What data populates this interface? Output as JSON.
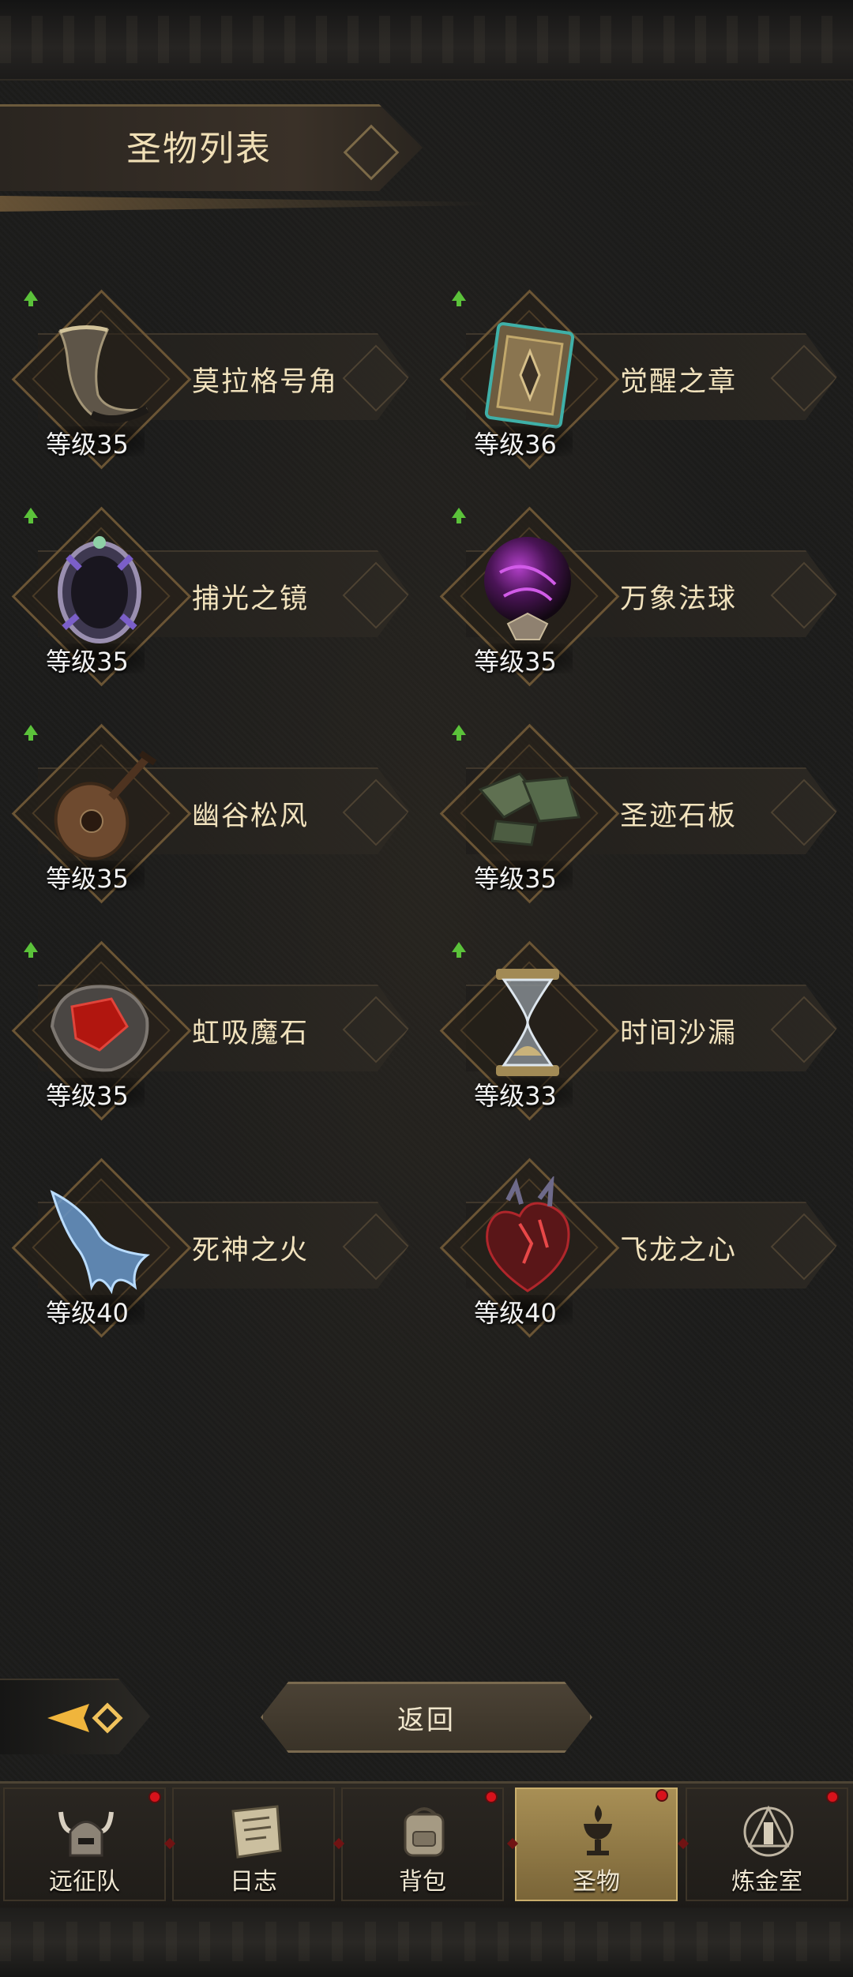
{
  "header": {
    "title": "圣物列表"
  },
  "relics": [
    {
      "name": "莫拉格号角",
      "level": "等级35",
      "upgrade": true,
      "icon": "horn-icon"
    },
    {
      "name": "觉醒之章",
      "level": "等级36",
      "upgrade": true,
      "icon": "tome-icon"
    },
    {
      "name": "捕光之镜",
      "level": "等级35",
      "upgrade": true,
      "icon": "mirror-icon"
    },
    {
      "name": "万象法球",
      "level": "等级35",
      "upgrade": true,
      "icon": "orb-icon"
    },
    {
      "name": "幽谷松风",
      "level": "等级35",
      "upgrade": true,
      "icon": "lute-icon"
    },
    {
      "name": "圣迹石板",
      "level": "等级35",
      "upgrade": true,
      "icon": "stone-tablet-icon"
    },
    {
      "name": "虹吸魔石",
      "level": "等级35",
      "upgrade": true,
      "icon": "siphon-stone-icon"
    },
    {
      "name": "时间沙漏",
      "level": "等级33",
      "upgrade": true,
      "icon": "hourglass-icon"
    },
    {
      "name": "死神之火",
      "level": "等级40",
      "upgrade": false,
      "icon": "spectral-hand-icon"
    },
    {
      "name": "飞龙之心",
      "level": "等级40",
      "upgrade": false,
      "icon": "dragon-heart-icon"
    }
  ],
  "actions": {
    "return_label": "返回"
  },
  "nav": {
    "items": [
      {
        "label": "远征队",
        "icon": "horned-helmet-icon",
        "badge": true,
        "active": false
      },
      {
        "label": "日志",
        "icon": "scroll-icon",
        "badge": false,
        "active": false
      },
      {
        "label": "背包",
        "icon": "backpack-icon",
        "badge": true,
        "active": false
      },
      {
        "label": "圣物",
        "icon": "chalice-icon",
        "badge": true,
        "active": true
      },
      {
        "label": "炼金室",
        "icon": "alchemy-icon",
        "badge": true,
        "active": false
      }
    ]
  },
  "colors": {
    "accent": "#c9ae6c",
    "badge": "#d8121b",
    "upgrade_arrow": "#5bc23a",
    "active_tab": "#a88f55"
  }
}
